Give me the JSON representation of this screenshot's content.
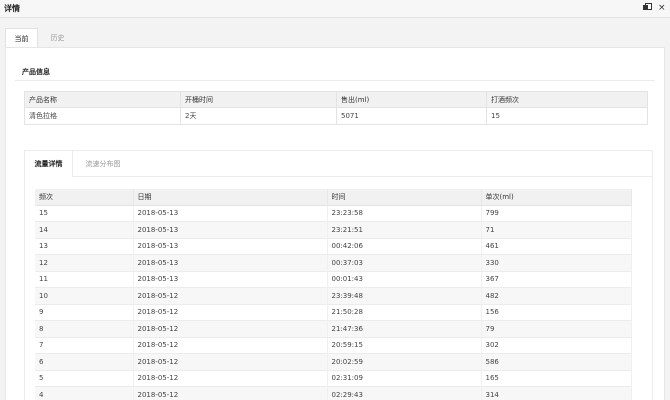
{
  "window": {
    "title": "详情",
    "maximize_icon": "restore-icon",
    "close_symbol": "×"
  },
  "tabs": [
    {
      "label": "当前",
      "active": true
    },
    {
      "label": "历史",
      "active": false
    }
  ],
  "product_section": {
    "title": "产品信息",
    "columns": [
      "产品名称",
      "开桶时间",
      "售出(ml)",
      "打酒频次"
    ],
    "row": [
      "清色拉格",
      "2天",
      "5071",
      "15"
    ]
  },
  "flow_section": {
    "tabs": [
      {
        "label": "流量详情",
        "active": true
      },
      {
        "label": "流速分布图",
        "active": false
      }
    ],
    "columns": [
      "频次",
      "日期",
      "时间",
      "单次(ml)"
    ],
    "rows": [
      [
        "15",
        "2018-05-13",
        "23:23:58",
        "799"
      ],
      [
        "14",
        "2018-05-13",
        "23:21:51",
        "71"
      ],
      [
        "13",
        "2018-05-13",
        "00:42:06",
        "461"
      ],
      [
        "12",
        "2018-05-13",
        "00:37:03",
        "330"
      ],
      [
        "11",
        "2018-05-13",
        "00:01:43",
        "367"
      ],
      [
        "10",
        "2018-05-12",
        "23:39:48",
        "482"
      ],
      [
        "9",
        "2018-05-12",
        "21:50:28",
        "156"
      ],
      [
        "8",
        "2018-05-12",
        "21:47:36",
        "79"
      ],
      [
        "7",
        "2018-05-12",
        "20:59:15",
        "302"
      ],
      [
        "6",
        "2018-05-12",
        "20:02:59",
        "586"
      ],
      [
        "5",
        "2018-05-12",
        "02:31:09",
        "165"
      ],
      [
        "4",
        "2018-05-12",
        "02:29:43",
        "314"
      ]
    ]
  }
}
